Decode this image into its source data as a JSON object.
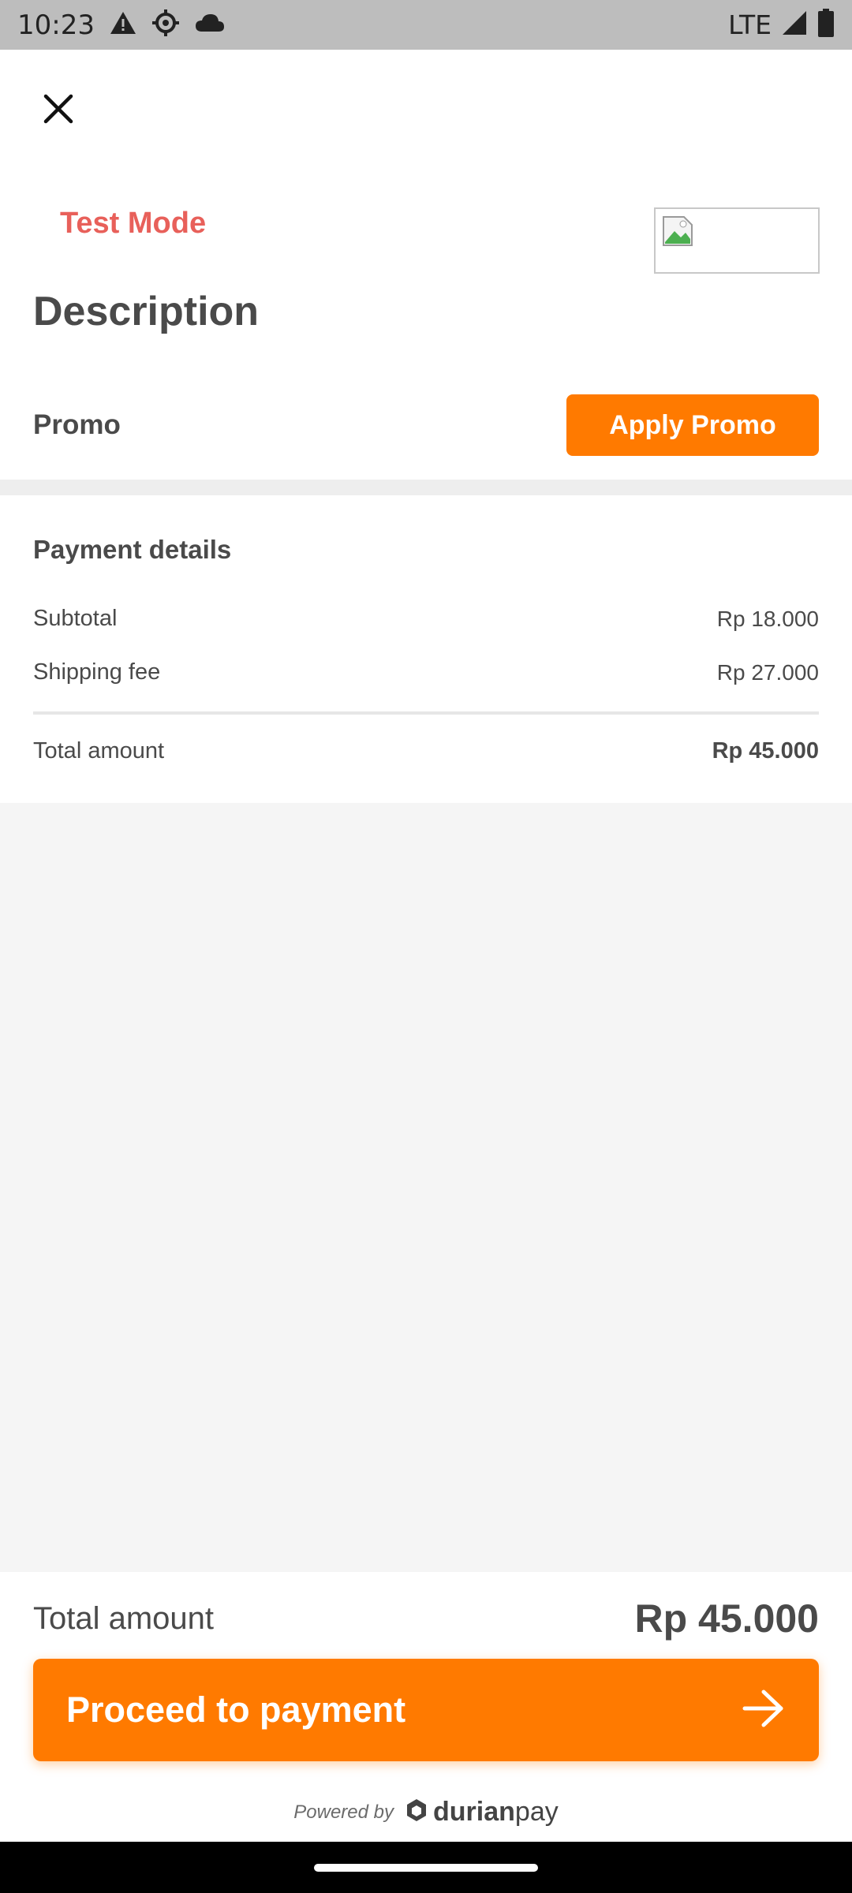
{
  "status_bar": {
    "time": "10:23",
    "network": "LTE",
    "icons": [
      "warning-icon",
      "settings-gear-icon",
      "cloud-icon",
      "signal-icon",
      "battery-icon"
    ]
  },
  "header": {
    "close_icon": "close-icon",
    "test_mode": "Test Mode",
    "title": "Description"
  },
  "promo": {
    "label": "Promo",
    "button_label": "Apply Promo"
  },
  "payment_details": {
    "title": "Payment details",
    "rows": [
      {
        "label": "Subtotal",
        "value": "Rp 18.000"
      },
      {
        "label": "Shipping fee",
        "value": "Rp 27.000"
      }
    ],
    "total_label": "Total amount",
    "total_value": "Rp 45.000"
  },
  "footer": {
    "total_label": "Total amount",
    "total_value": "Rp 45.000",
    "proceed_label": "Proceed to payment",
    "powered_by": "Powered by",
    "brand_bold": "durian",
    "brand_light": "pay"
  },
  "colors": {
    "accent": "#ff7a00",
    "test_mode": "#e8605a",
    "text": "#4a4a4a",
    "background_gray": "#f5f5f5"
  }
}
